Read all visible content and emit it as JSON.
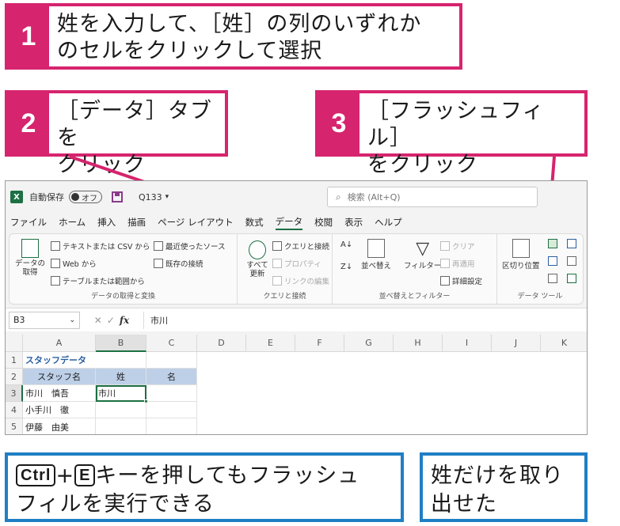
{
  "callouts": {
    "step1": {
      "num": "1",
      "text_line1": "姓を入力して、［姓］の列のいずれか",
      "text_line2": "のセルをクリックして選択"
    },
    "step2": {
      "num": "2",
      "text_line1": "［データ］タブを",
      "text_line2": "クリック"
    },
    "step3": {
      "num": "3",
      "text_line1": "［フラッシュフィル］",
      "text_line2": "をクリック"
    },
    "note_shortcut": {
      "key_ctrl": "Ctrl",
      "plus": "+",
      "key_e": "E",
      "text_line1": "キーを押してもフラッシュ",
      "text_line2": "フィルを実行できる"
    },
    "note_result": {
      "text_line1": "姓だけを取り",
      "text_line2": "出せた"
    }
  },
  "colors": {
    "pink": "#d6246e",
    "blue": "#1f7fc4",
    "excel_green": "#1d7044",
    "header_fill": "#bdd0e8"
  },
  "titlebar": {
    "autosave_label": "自動保存",
    "toggle_state": "オフ",
    "file_name": "Q133",
    "file_dropdown": "▾",
    "search_placeholder": "検索 (Alt+Q)"
  },
  "menu": [
    "ファイル",
    "ホーム",
    "挿入",
    "描画",
    "ページ レイアウト",
    "数式",
    "データ",
    "校閲",
    "表示",
    "ヘルプ"
  ],
  "ribbon": {
    "get_data": {
      "big_button": "データの\n取得",
      "text_csv": "テキストまたは CSV から",
      "web": "Web から",
      "table_range": "テーブルまたは範囲から",
      "recent_sources": "最近使ったソース",
      "existing_conn": "既存の接続",
      "group_label": "データの取得と変換"
    },
    "queries": {
      "refresh_all": "すべて\n更新",
      "queries_conn": "クエリと接続",
      "properties": "プロパティ",
      "edit_links": "リンクの編集",
      "group_label": "クエリと接続"
    },
    "sort_filter": {
      "sort": "並べ替え",
      "filter": "フィルター",
      "clear": "クリア",
      "reapply": "再適用",
      "advanced": "詳細設定",
      "group_label": "並べ替えとフィルター"
    },
    "data_tools": {
      "text_to_columns": "区切り位置",
      "group_label": "データ ツール"
    }
  },
  "formula_bar": {
    "name_box": "B3",
    "fx": "fx",
    "value": "市川"
  },
  "grid": {
    "columns": [
      "A",
      "B",
      "C",
      "D",
      "E",
      "F",
      "G",
      "H",
      "I",
      "J",
      "K"
    ],
    "rows": [
      "1",
      "2",
      "3",
      "4",
      "5"
    ],
    "a1": "スタッフデータ",
    "headers": [
      "スタッフ名",
      "姓",
      "名"
    ],
    "data": [
      {
        "name": "市川　慎吾",
        "sei": "市川",
        "mei": ""
      },
      {
        "name": "小手川　徹",
        "sei": "",
        "mei": ""
      },
      {
        "name": "伊藤　由美",
        "sei": "",
        "mei": ""
      }
    ]
  }
}
